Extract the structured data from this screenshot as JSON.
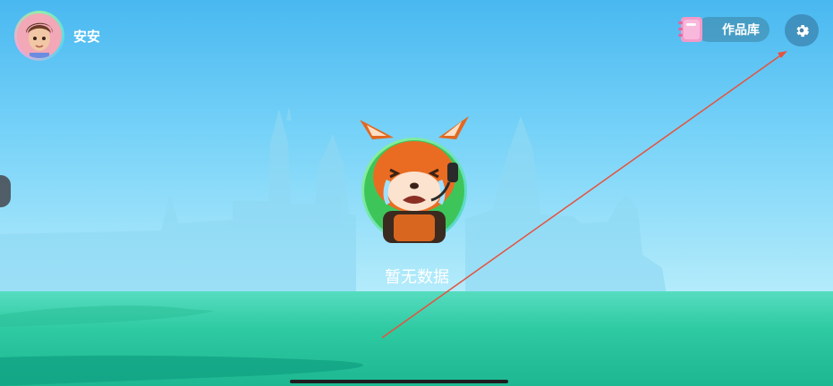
{
  "profile": {
    "username": "安安"
  },
  "toolbar": {
    "works_label": "作品库"
  },
  "empty_state": {
    "message": "暂无数据"
  },
  "icons": {
    "settings": "gear-icon",
    "works": "notebook-icon",
    "mascot": "crying-fox-mascot"
  },
  "colors": {
    "sky_top": "#49b8f0",
    "ground": "#2ecaa2",
    "annotation_arrow": "#e5533f"
  }
}
